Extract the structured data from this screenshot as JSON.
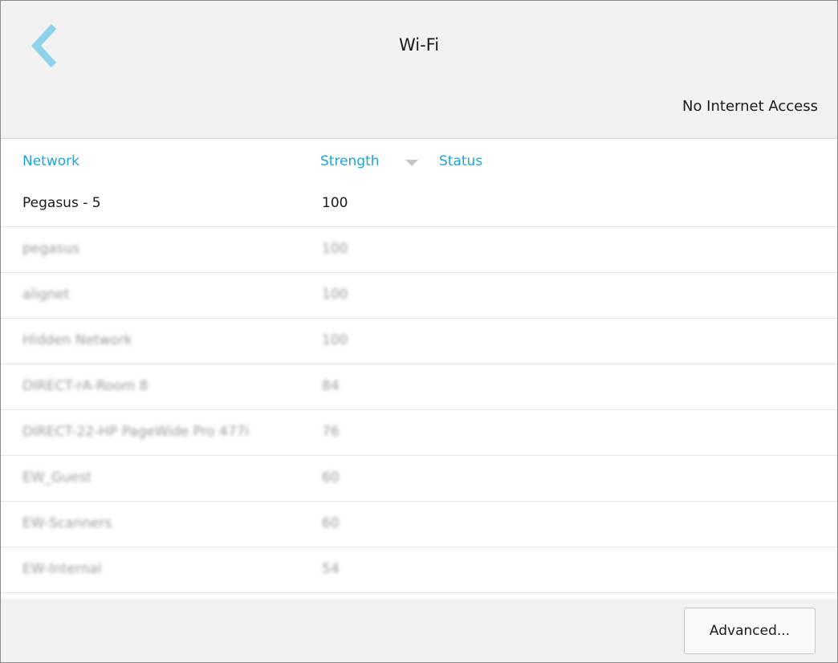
{
  "header": {
    "title": "Wi-Fi",
    "connection_status": "No Internet Access",
    "back_icon": "chevron-left-icon",
    "accent_color": "#1fa3d8"
  },
  "table": {
    "columns": {
      "network": "Network",
      "strength": "Strength",
      "status": "Status"
    },
    "sort_icon": "sort-descending-icon",
    "rows": [
      {
        "network": "Pegasus - 5",
        "strength": "100",
        "status": ""
      },
      {
        "network": "pegasus",
        "strength": "100",
        "status": ""
      },
      {
        "network": "alignet",
        "strength": "100",
        "status": ""
      },
      {
        "network": "Hidden Network",
        "strength": "100",
        "status": ""
      },
      {
        "network": "DIRECT-rA-Room 8",
        "strength": "84",
        "status": ""
      },
      {
        "network": "DIRECT-22-HP PageWide Pro 477i",
        "strength": "76",
        "status": ""
      },
      {
        "network": "EW_Guest",
        "strength": "60",
        "status": ""
      },
      {
        "network": "EW-Scanners",
        "strength": "60",
        "status": ""
      },
      {
        "network": "EW-Internal",
        "strength": "54",
        "status": ""
      }
    ]
  },
  "footer": {
    "advanced_label": "Advanced..."
  }
}
